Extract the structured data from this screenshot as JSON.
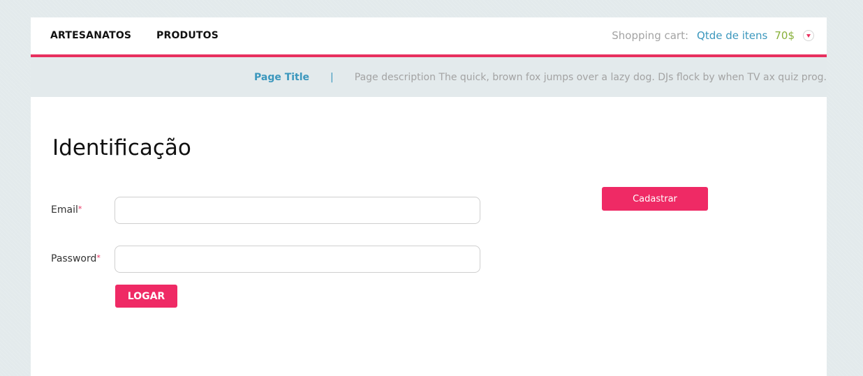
{
  "nav": {
    "items": [
      {
        "label": "ARTESANATOS"
      },
      {
        "label": "PRODUTOS"
      }
    ]
  },
  "cart": {
    "label": "Shopping cart:",
    "items_link": "Qtde de itens",
    "total": "70$",
    "toggle_icon": "chevron-down-icon"
  },
  "subheader": {
    "title": "Page Title",
    "separator": "|",
    "description": "Page description The quick, brown fox jumps over a lazy dog. DJs flock by when TV ax quiz prog."
  },
  "login": {
    "heading": "Identificação",
    "email_label": "Email",
    "password_label": "Password",
    "required_mark": "*",
    "email_value": "",
    "password_value": "",
    "login_button": "LOGAR"
  },
  "register": {
    "button": "Cadastrar"
  },
  "colors": {
    "accent": "#e8305f",
    "link": "#3b97bd",
    "price": "#88b03a",
    "background": "#e3eaec"
  }
}
